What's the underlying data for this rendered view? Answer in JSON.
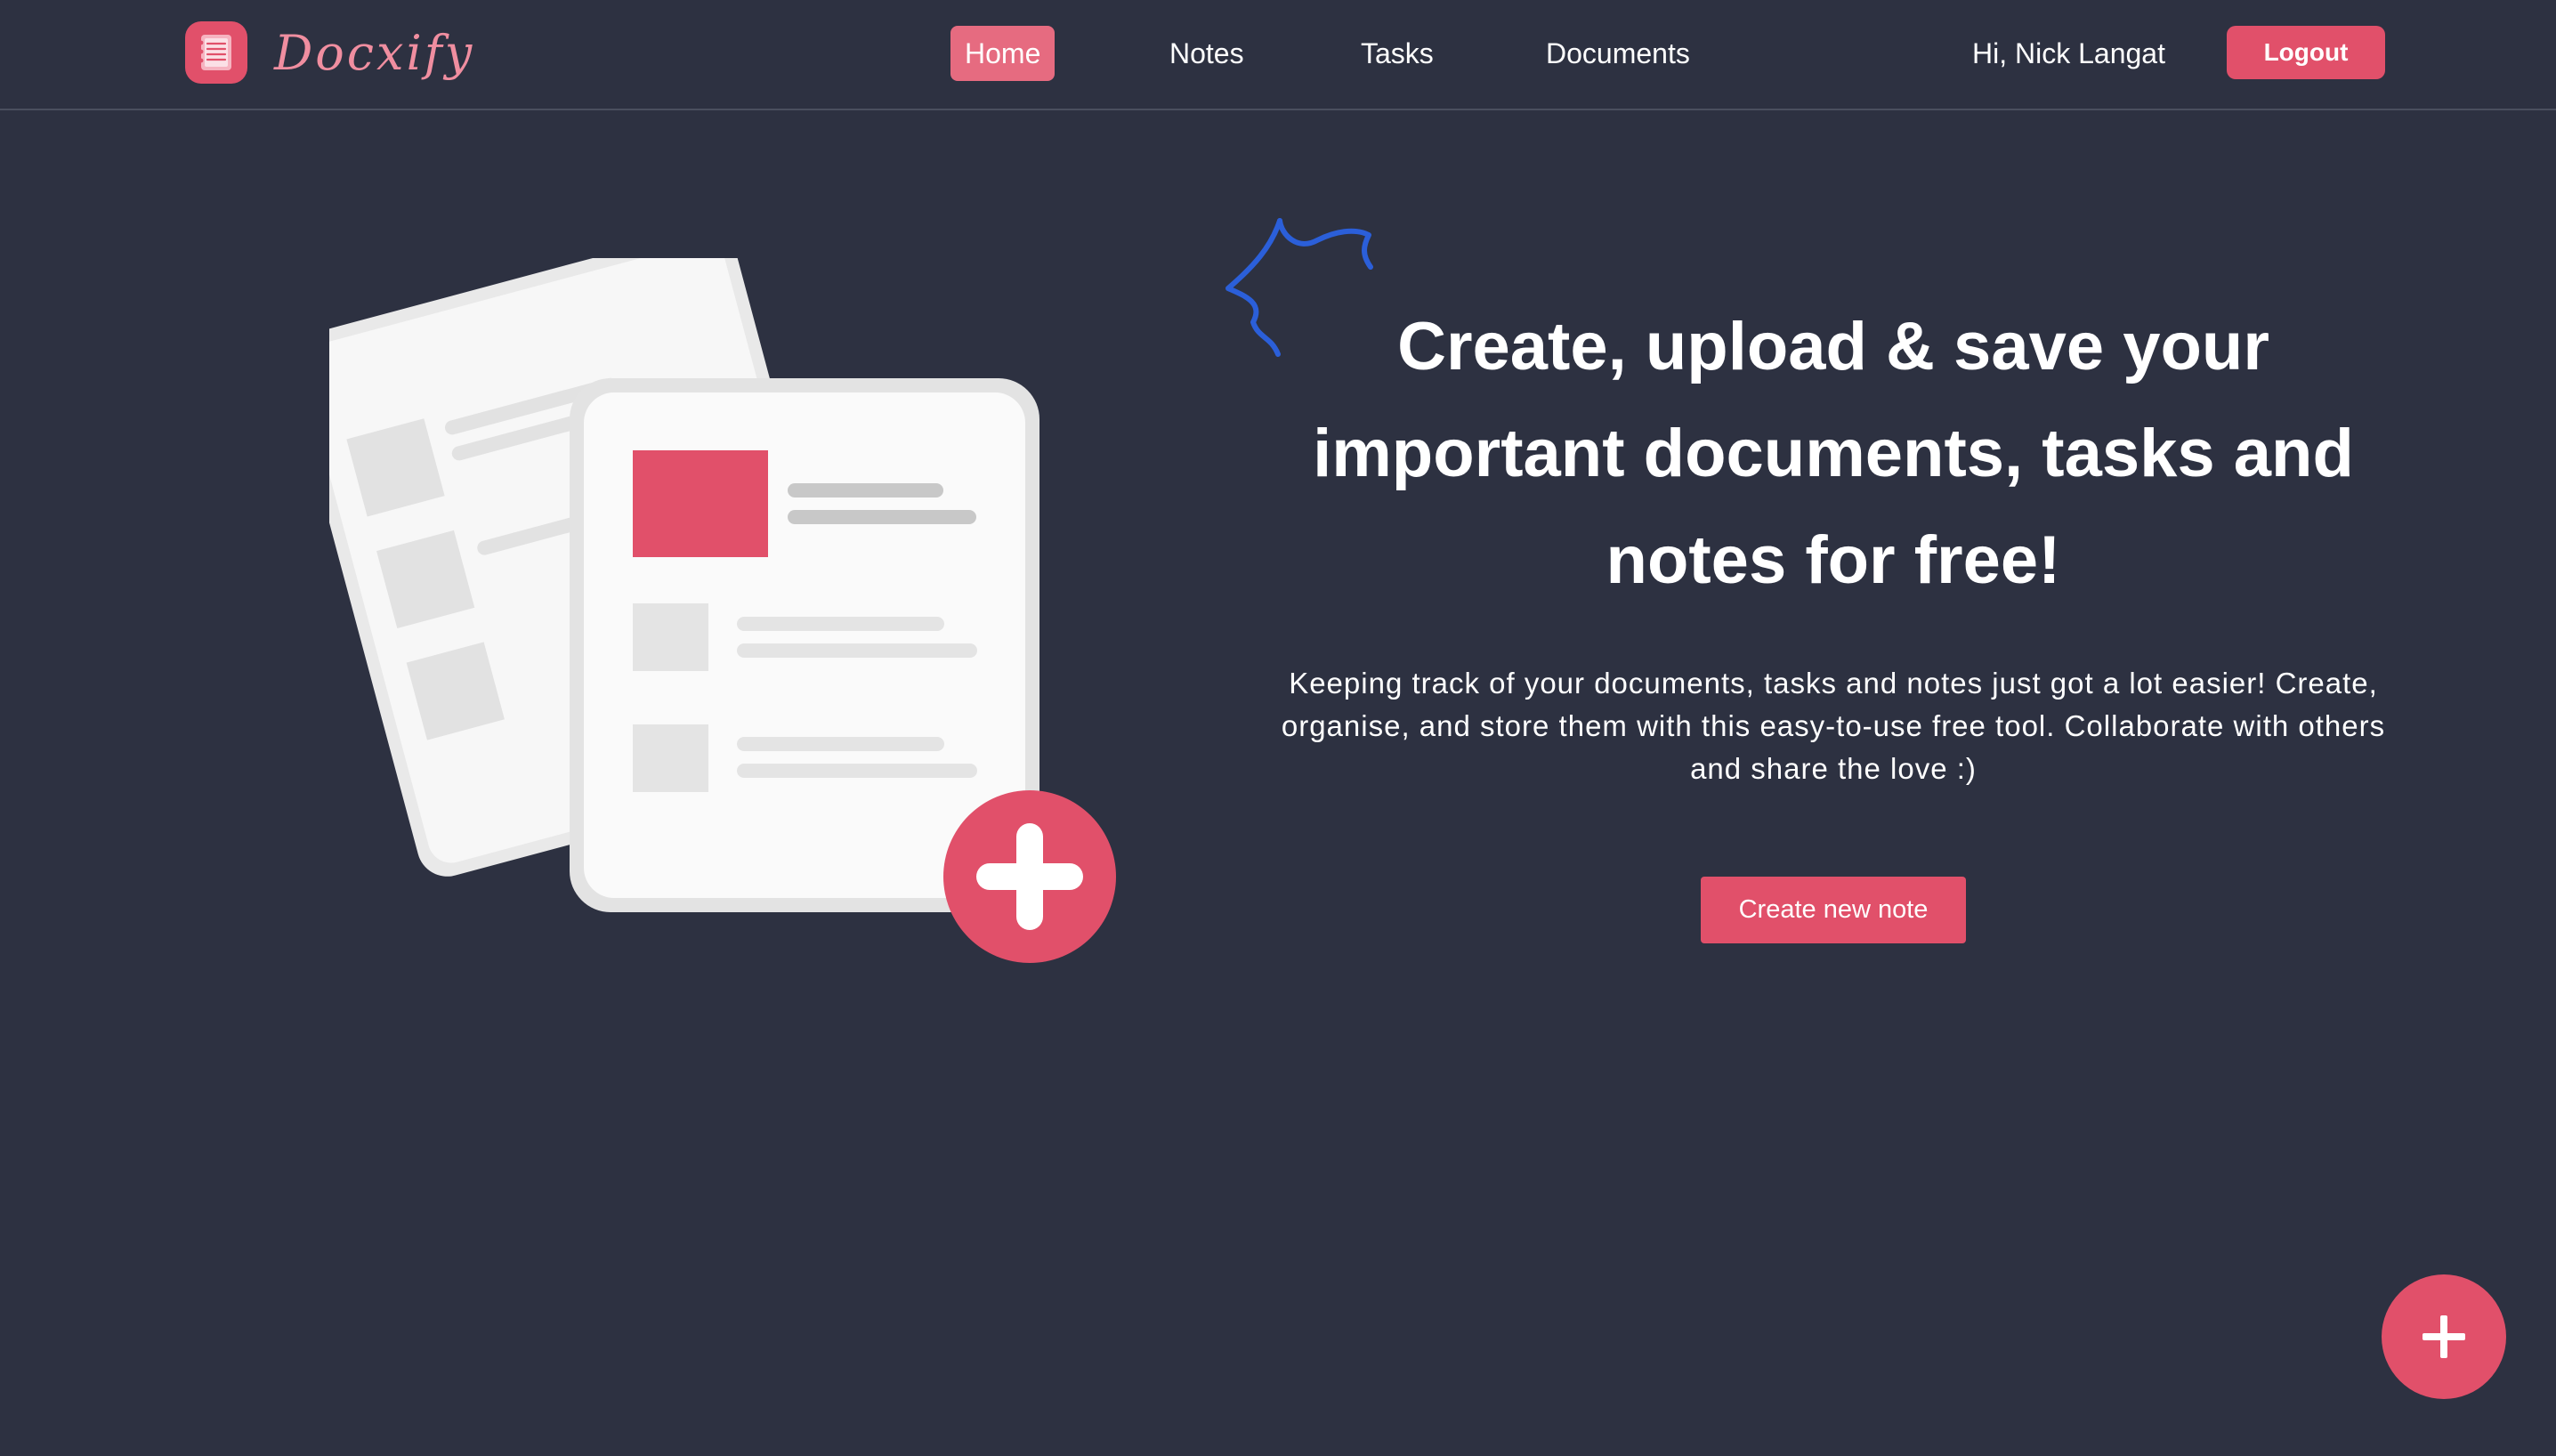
{
  "brand": {
    "name": "Docxify",
    "accent_color": "#e1506a",
    "logo_icon": "notepad-icon"
  },
  "nav": {
    "items": [
      {
        "label": "Home",
        "active": true
      },
      {
        "label": "Notes",
        "active": false
      },
      {
        "label": "Tasks",
        "active": false
      },
      {
        "label": "Documents",
        "active": false
      }
    ],
    "greeting": "Hi, Nick Langat",
    "logout_label": "Logout"
  },
  "hero": {
    "title": "Create, upload & save your important documents, tasks and notes for free!",
    "description": "Keeping track of your documents, tasks and notes just got a lot easier! Create, organise, and store them with this easy-to-use free tool. Collaborate with others and share the love :)",
    "cta_label": "Create new note",
    "illustration_icon": "documents-plus-illustration",
    "decoration_icon": "sparkle-icon"
  },
  "fab": {
    "icon": "plus-icon",
    "label": "+"
  },
  "colors": {
    "background": "#2d3141",
    "accent": "#e1506a",
    "nav_active": "#e66b80",
    "sparkle": "#2b5fd9"
  }
}
